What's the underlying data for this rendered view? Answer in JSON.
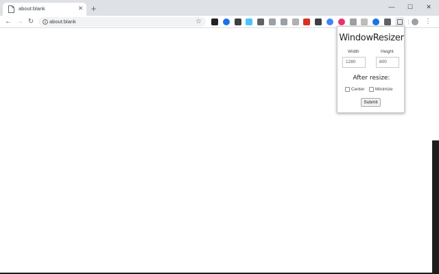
{
  "browser": {
    "tab_title": "about:blank",
    "tab_close_icon": "close-icon",
    "new_tab_icon": "plus-icon",
    "window_controls": {
      "minimize": "—",
      "maximize": "☐",
      "close": "✕"
    },
    "nav": {
      "back": "←",
      "forward": "→",
      "reload": "↻"
    },
    "url": "about:blank",
    "bookmark_icon": "☆",
    "menu_icon": "⋮"
  },
  "extensions": [
    {
      "name": "ext-1",
      "color": "#202124"
    },
    {
      "name": "ext-2",
      "color": "#1a73e8"
    },
    {
      "name": "ext-3",
      "color": "#3c4043"
    },
    {
      "name": "ext-4",
      "color": "#4fc3f7"
    },
    {
      "name": "ext-5",
      "color": "#5f6368"
    },
    {
      "name": "ext-6",
      "color": "#9aa0a6"
    },
    {
      "name": "ext-7",
      "color": "#9aa0a6"
    },
    {
      "name": "ext-8",
      "color": "#b0b0b0"
    },
    {
      "name": "ext-9",
      "color": "#d93025"
    },
    {
      "name": "ext-10",
      "color": "#3c4043"
    },
    {
      "name": "ext-11",
      "color": "#4285f4"
    },
    {
      "name": "ext-12",
      "color": "#e8336d"
    },
    {
      "name": "ext-13",
      "color": "#9aa0a6"
    },
    {
      "name": "ext-14",
      "color": "#bdbdbd"
    },
    {
      "name": "ext-15",
      "color": "#1a73e8"
    },
    {
      "name": "ext-16",
      "color": "#5f6368"
    }
  ],
  "popup": {
    "title": "WindowResizer",
    "width_label": "Width",
    "height_label": "Height",
    "width_value": "1280",
    "height_value": "800",
    "after_resize_label": "After resize:",
    "center_label": "Center",
    "minimize_label": "Minimize",
    "center_checked": false,
    "minimize_checked": false,
    "submit_label": "Submit"
  }
}
